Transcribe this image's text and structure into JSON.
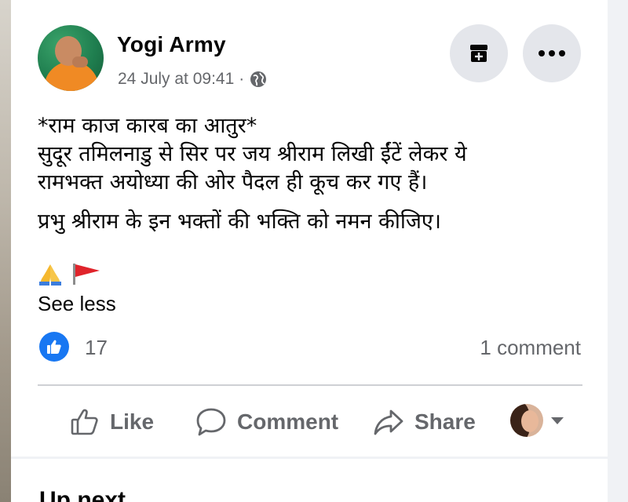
{
  "post": {
    "author": "Yogi Army",
    "timestamp": "24 July at 09:41",
    "separator": "·",
    "privacy_icon": "globe-icon",
    "line1": "*राम काज कारब का आतुर*",
    "line2": "सुदूर तमिलनाडु से सिर पर जय श्रीराम लिखी ईंटें लेकर ये",
    "line3": "रामभक्त अयोध्या की ओर पैदल ही कूच कर गए हैं।",
    "line4": "प्रभु श्रीराम के इन भक्तों की भक्ति को नमन कीजिए।",
    "emoji_pray": "🙏",
    "emoji_flag": "🚩",
    "see_less": "See less"
  },
  "reactions": {
    "like_count": "17",
    "comment_count": "1 comment"
  },
  "actions": {
    "like": "Like",
    "comment": "Comment",
    "share": "Share"
  },
  "next_section": {
    "title": "Up next"
  },
  "colors": {
    "accent": "#1877f2",
    "secondary_text": "#65676b",
    "button_bg": "#e4e6eb"
  }
}
